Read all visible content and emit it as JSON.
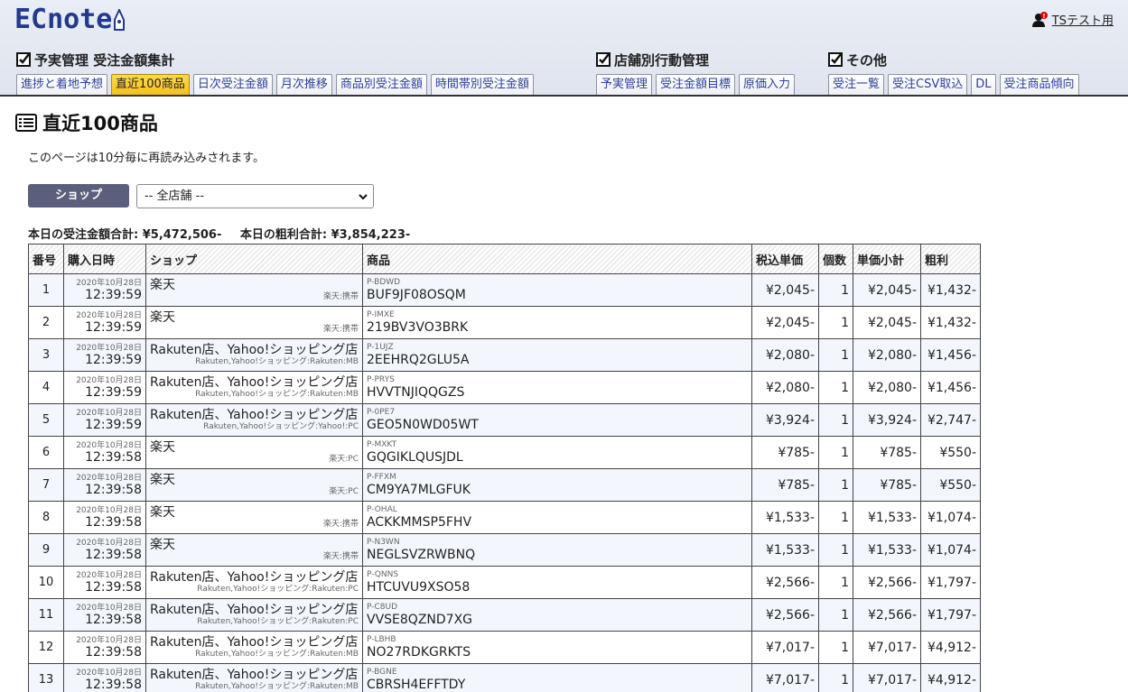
{
  "header": {
    "logo": "ECnote",
    "user_label": "TSテスト用",
    "notification_count": "!"
  },
  "nav": {
    "groups": [
      {
        "title": "予実管理 受注金額集計",
        "tabs": [
          "進捗と着地予想",
          "直近100商品",
          "日次受注金額",
          "月次推移",
          "商品別受注金額",
          "時間帯別受注金額"
        ]
      },
      {
        "title": "店舗別行動管理",
        "tabs": [
          "予実管理",
          "受注金額目標",
          "原価入力"
        ]
      },
      {
        "title": "その他",
        "tabs": [
          "受注一覧",
          "受注CSV取込",
          "DL",
          "受注商品傾向"
        ]
      }
    ],
    "active_tab": "直近100商品"
  },
  "page": {
    "title": "直近100商品",
    "notice": "このページは10分毎に再読み込みされます。",
    "shop_button": "ショップ",
    "shop_select_value": "-- 全店舗 --",
    "total_sales": "本日の受注金額合計: ¥5,472,506-",
    "total_profit": "本日の粗利合計: ¥3,854,223-"
  },
  "table": {
    "headers": [
      "番号",
      "購入日時",
      "ショップ",
      "商品",
      "税込単価",
      "個数",
      "単価小計",
      "粗利"
    ],
    "rows": [
      {
        "no": "1",
        "date": "2020年10月28日",
        "time": "12:39:59",
        "shop": "楽天",
        "shop_sub": "楽天:携帯",
        "code": "P-BDWD",
        "product": "BUF9JF08OSQM",
        "price": "¥2,045-",
        "qty": "1",
        "subtotal": "¥2,045-",
        "profit": "¥1,432-"
      },
      {
        "no": "2",
        "date": "2020年10月28日",
        "time": "12:39:59",
        "shop": "楽天",
        "shop_sub": "楽天:携帯",
        "code": "P-IMXE",
        "product": "219BV3VO3BRK",
        "price": "¥2,045-",
        "qty": "1",
        "subtotal": "¥2,045-",
        "profit": "¥1,432-"
      },
      {
        "no": "3",
        "date": "2020年10月28日",
        "time": "12:39:59",
        "shop": "Rakuten店、Yahoo!ショッピング店",
        "shop_sub": "Rakuten,Yahoo!ショッピング:Rakuten:MB",
        "code": "P-1UJZ",
        "product": "2EEHRQ2GLU5A",
        "price": "¥2,080-",
        "qty": "1",
        "subtotal": "¥2,080-",
        "profit": "¥1,456-"
      },
      {
        "no": "4",
        "date": "2020年10月28日",
        "time": "12:39:59",
        "shop": "Rakuten店、Yahoo!ショッピング店",
        "shop_sub": "Rakuten,Yahoo!ショッピング:Rakuten:MB",
        "code": "P-PRYS",
        "product": "HVVTNJIQQGZS",
        "price": "¥2,080-",
        "qty": "1",
        "subtotal": "¥2,080-",
        "profit": "¥1,456-"
      },
      {
        "no": "5",
        "date": "2020年10月28日",
        "time": "12:39:59",
        "shop": "Rakuten店、Yahoo!ショッピング店",
        "shop_sub": "Rakuten,Yahoo!ショッピング:Yahoo!:PC",
        "code": "P-0PE7",
        "product": "GEO5N0WD05WT",
        "price": "¥3,924-",
        "qty": "1",
        "subtotal": "¥3,924-",
        "profit": "¥2,747-"
      },
      {
        "no": "6",
        "date": "2020年10月28日",
        "time": "12:39:58",
        "shop": "楽天",
        "shop_sub": "楽天:PC",
        "code": "P-MXKT",
        "product": "GQGIKLQUSJDL",
        "price": "¥785-",
        "qty": "1",
        "subtotal": "¥785-",
        "profit": "¥550-"
      },
      {
        "no": "7",
        "date": "2020年10月28日",
        "time": "12:39:58",
        "shop": "楽天",
        "shop_sub": "楽天:PC",
        "code": "P-FFXM",
        "product": "CM9YA7MLGFUK",
        "price": "¥785-",
        "qty": "1",
        "subtotal": "¥785-",
        "profit": "¥550-"
      },
      {
        "no": "8",
        "date": "2020年10月28日",
        "time": "12:39:58",
        "shop": "楽天",
        "shop_sub": "楽天:携帯",
        "code": "P-OHAL",
        "product": "ACKKMMSP5FHV",
        "price": "¥1,533-",
        "qty": "1",
        "subtotal": "¥1,533-",
        "profit": "¥1,074-"
      },
      {
        "no": "9",
        "date": "2020年10月28日",
        "time": "12:39:58",
        "shop": "楽天",
        "shop_sub": "楽天:携帯",
        "code": "P-N3WN",
        "product": "NEGLSVZRWBNQ",
        "price": "¥1,533-",
        "qty": "1",
        "subtotal": "¥1,533-",
        "profit": "¥1,074-"
      },
      {
        "no": "10",
        "date": "2020年10月28日",
        "time": "12:39:58",
        "shop": "Rakuten店、Yahoo!ショッピング店",
        "shop_sub": "Rakuten,Yahoo!ショッピング:Rakuten:PC",
        "code": "P-QNNS",
        "product": "HTCUVU9XSO58",
        "price": "¥2,566-",
        "qty": "1",
        "subtotal": "¥2,566-",
        "profit": "¥1,797-"
      },
      {
        "no": "11",
        "date": "2020年10月28日",
        "time": "12:39:58",
        "shop": "Rakuten店、Yahoo!ショッピング店",
        "shop_sub": "Rakuten,Yahoo!ショッピング:Rakuten:PC",
        "code": "P-C8UD",
        "product": "VVSE8QZND7XG",
        "price": "¥2,566-",
        "qty": "1",
        "subtotal": "¥2,566-",
        "profit": "¥1,797-"
      },
      {
        "no": "12",
        "date": "2020年10月28日",
        "time": "12:39:58",
        "shop": "Rakuten店、Yahoo!ショッピング店",
        "shop_sub": "Rakuten,Yahoo!ショッピング:Rakuten:MB",
        "code": "P-LBHB",
        "product": "NO27RDKGRKTS",
        "price": "¥7,017-",
        "qty": "1",
        "subtotal": "¥7,017-",
        "profit": "¥4,912-"
      },
      {
        "no": "13",
        "date": "2020年10月28日",
        "time": "12:39:58",
        "shop": "Rakuten店、Yahoo!ショッピング店",
        "shop_sub": "Rakuten,Yahoo!ショッピング:Rakuten:MB",
        "code": "P-BGNE",
        "product": "CBRSH4EFFTDY",
        "price": "¥7,017-",
        "qty": "1",
        "subtotal": "¥7,017-",
        "profit": "¥4,912-"
      }
    ]
  }
}
